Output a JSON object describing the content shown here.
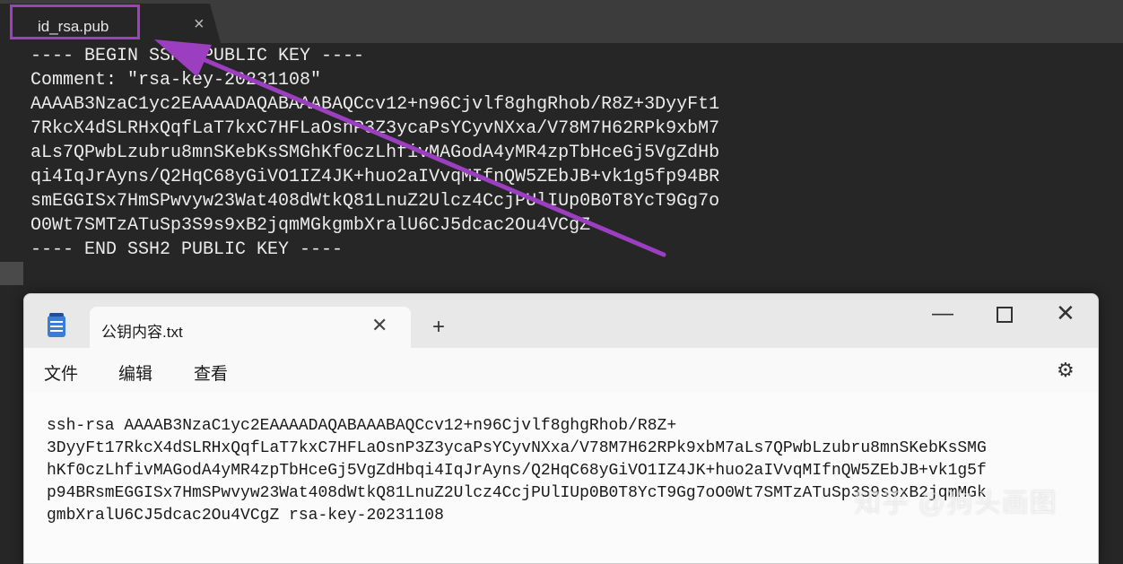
{
  "background_editor": {
    "tab_label": "id_rsa.pub",
    "tab_close": "×",
    "lines": [
      "---- BEGIN SSH2 PUBLIC KEY ----",
      "Comment: \"rsa-key-20231108\"",
      "AAAAB3NzaC1yc2EAAAADAQABAAABAQCcv12+n96Cjvlf8ghgRhob/R8Z+3DyyFt1",
      "7RkcX4dSLRHxQqfLaT7kxC7HFLaOsnP3Z3ycaPsYCyvNXxa/V78M7H62RPk9xbM7",
      "aLs7QPwbLzubru8mnSKebKsSMGhKf0czLhfivMAGodA4yMR4zpTbHceGj5VgZdHb",
      "qi4IqJrAyns/Q2HqC68yGiVO1IZ4JK+huo2aIVvqMIfnQW5ZEbJB+vk1g5fp94BR",
      "smEGGISx7HmSPwvyw23Wat408dWtkQ81LnuZ2Ulcz4CcjPUlIUp0B0T8YcT9Gg7o",
      "O0Wt7SMTzATuSp3S9s9xB2jqmMGkgmbXralU6CJ5dcac2Ou4VCgZ",
      "---- END SSH2 PUBLIC KEY ----"
    ]
  },
  "notepad": {
    "tab_label": "公钥内容.txt",
    "tab_close": "✕",
    "new_tab": "+",
    "window_controls": {
      "minimize": "—",
      "close": "✕"
    },
    "menu": {
      "file": "文件",
      "edit": "编辑",
      "view": "查看"
    },
    "settings_icon": "⚙",
    "content_lines": [
      "ssh-rsa AAAAB3NzaC1yc2EAAAADAQABAAABAQCcv12+n96Cjvlf8ghgRhob/R8Z+",
      "3DyyFt17RkcX4dSLRHxQqfLaT7kxC7HFLaOsnP3Z3ycaPsYCyvNXxa/V78M7H62RPk9xbM7aLs7QPwbLzubru8mnSKebKsSMG",
      "hKf0czLhfivMAGodA4yMR4zpTbHceGj5VgZdHbqi4IqJrAyns/Q2HqC68yGiVO1IZ4JK+huo2aIVvqMIfnQW5ZEbJB+vk1g5f",
      "p94BRsmEGGISx7HmSPwvyw23Wat408dWtkQ81LnuZ2Ulcz4CcjPUlIUp0B0T8YcT9Gg7oO0Wt7SMTzATuSp3S9s9xB2jqmMGk",
      "gmbXralU6CJ5dcac2Ou4VCgZ rsa-key-20231108"
    ]
  },
  "watermark": "知乎 @狗头画图",
  "colors": {
    "highlight": "#a23fc0",
    "arrow": "#9b3fc0"
  }
}
